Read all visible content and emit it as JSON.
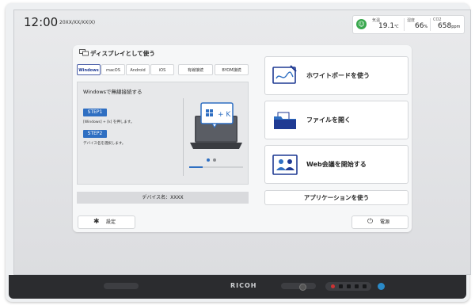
{
  "status_bar": {
    "time": "12:00",
    "date": "20XX/XX/XX(X)",
    "environment": [
      {
        "label": "気温",
        "value": "19.1",
        "unit": "℃"
      },
      {
        "label": "湿度",
        "value": "66",
        "unit": "%"
      },
      {
        "label": "CO2",
        "value": "658",
        "unit": "ppm"
      }
    ],
    "status_icon": "smiley-icon",
    "status_color": "#39a84e"
  },
  "display_panel": {
    "title": "ディスプレイとして使う",
    "tabs": [
      "Windows",
      "macOS",
      "Android",
      "iOS",
      "有線接続",
      "BYOM接続"
    ],
    "active_tab": "Windows",
    "guide": {
      "title": "Windowsで無線接続する",
      "steps": [
        {
          "label": "STEP1",
          "desc": "[Windows] + [k] を押します。"
        },
        {
          "label": "STEP2",
          "desc": "デバイス名を選択します。"
        }
      ],
      "illustration_text": "+ K",
      "page_count": 2,
      "current_page": 1,
      "progress": 0.25
    },
    "device_name": "デバイス名：XXXX"
  },
  "actions": {
    "whiteboard": "ホワイトボードを使う",
    "open_file": "ファイルを開く",
    "web_meeting": "Web会議を開始する",
    "apps": "アプリケーションを使う",
    "settings": "設定",
    "power": "電源"
  },
  "hardware": {
    "brand": "RICOH"
  },
  "colors": {
    "accent": "#2f6fc2",
    "tab_active": "#1f3a93"
  }
}
